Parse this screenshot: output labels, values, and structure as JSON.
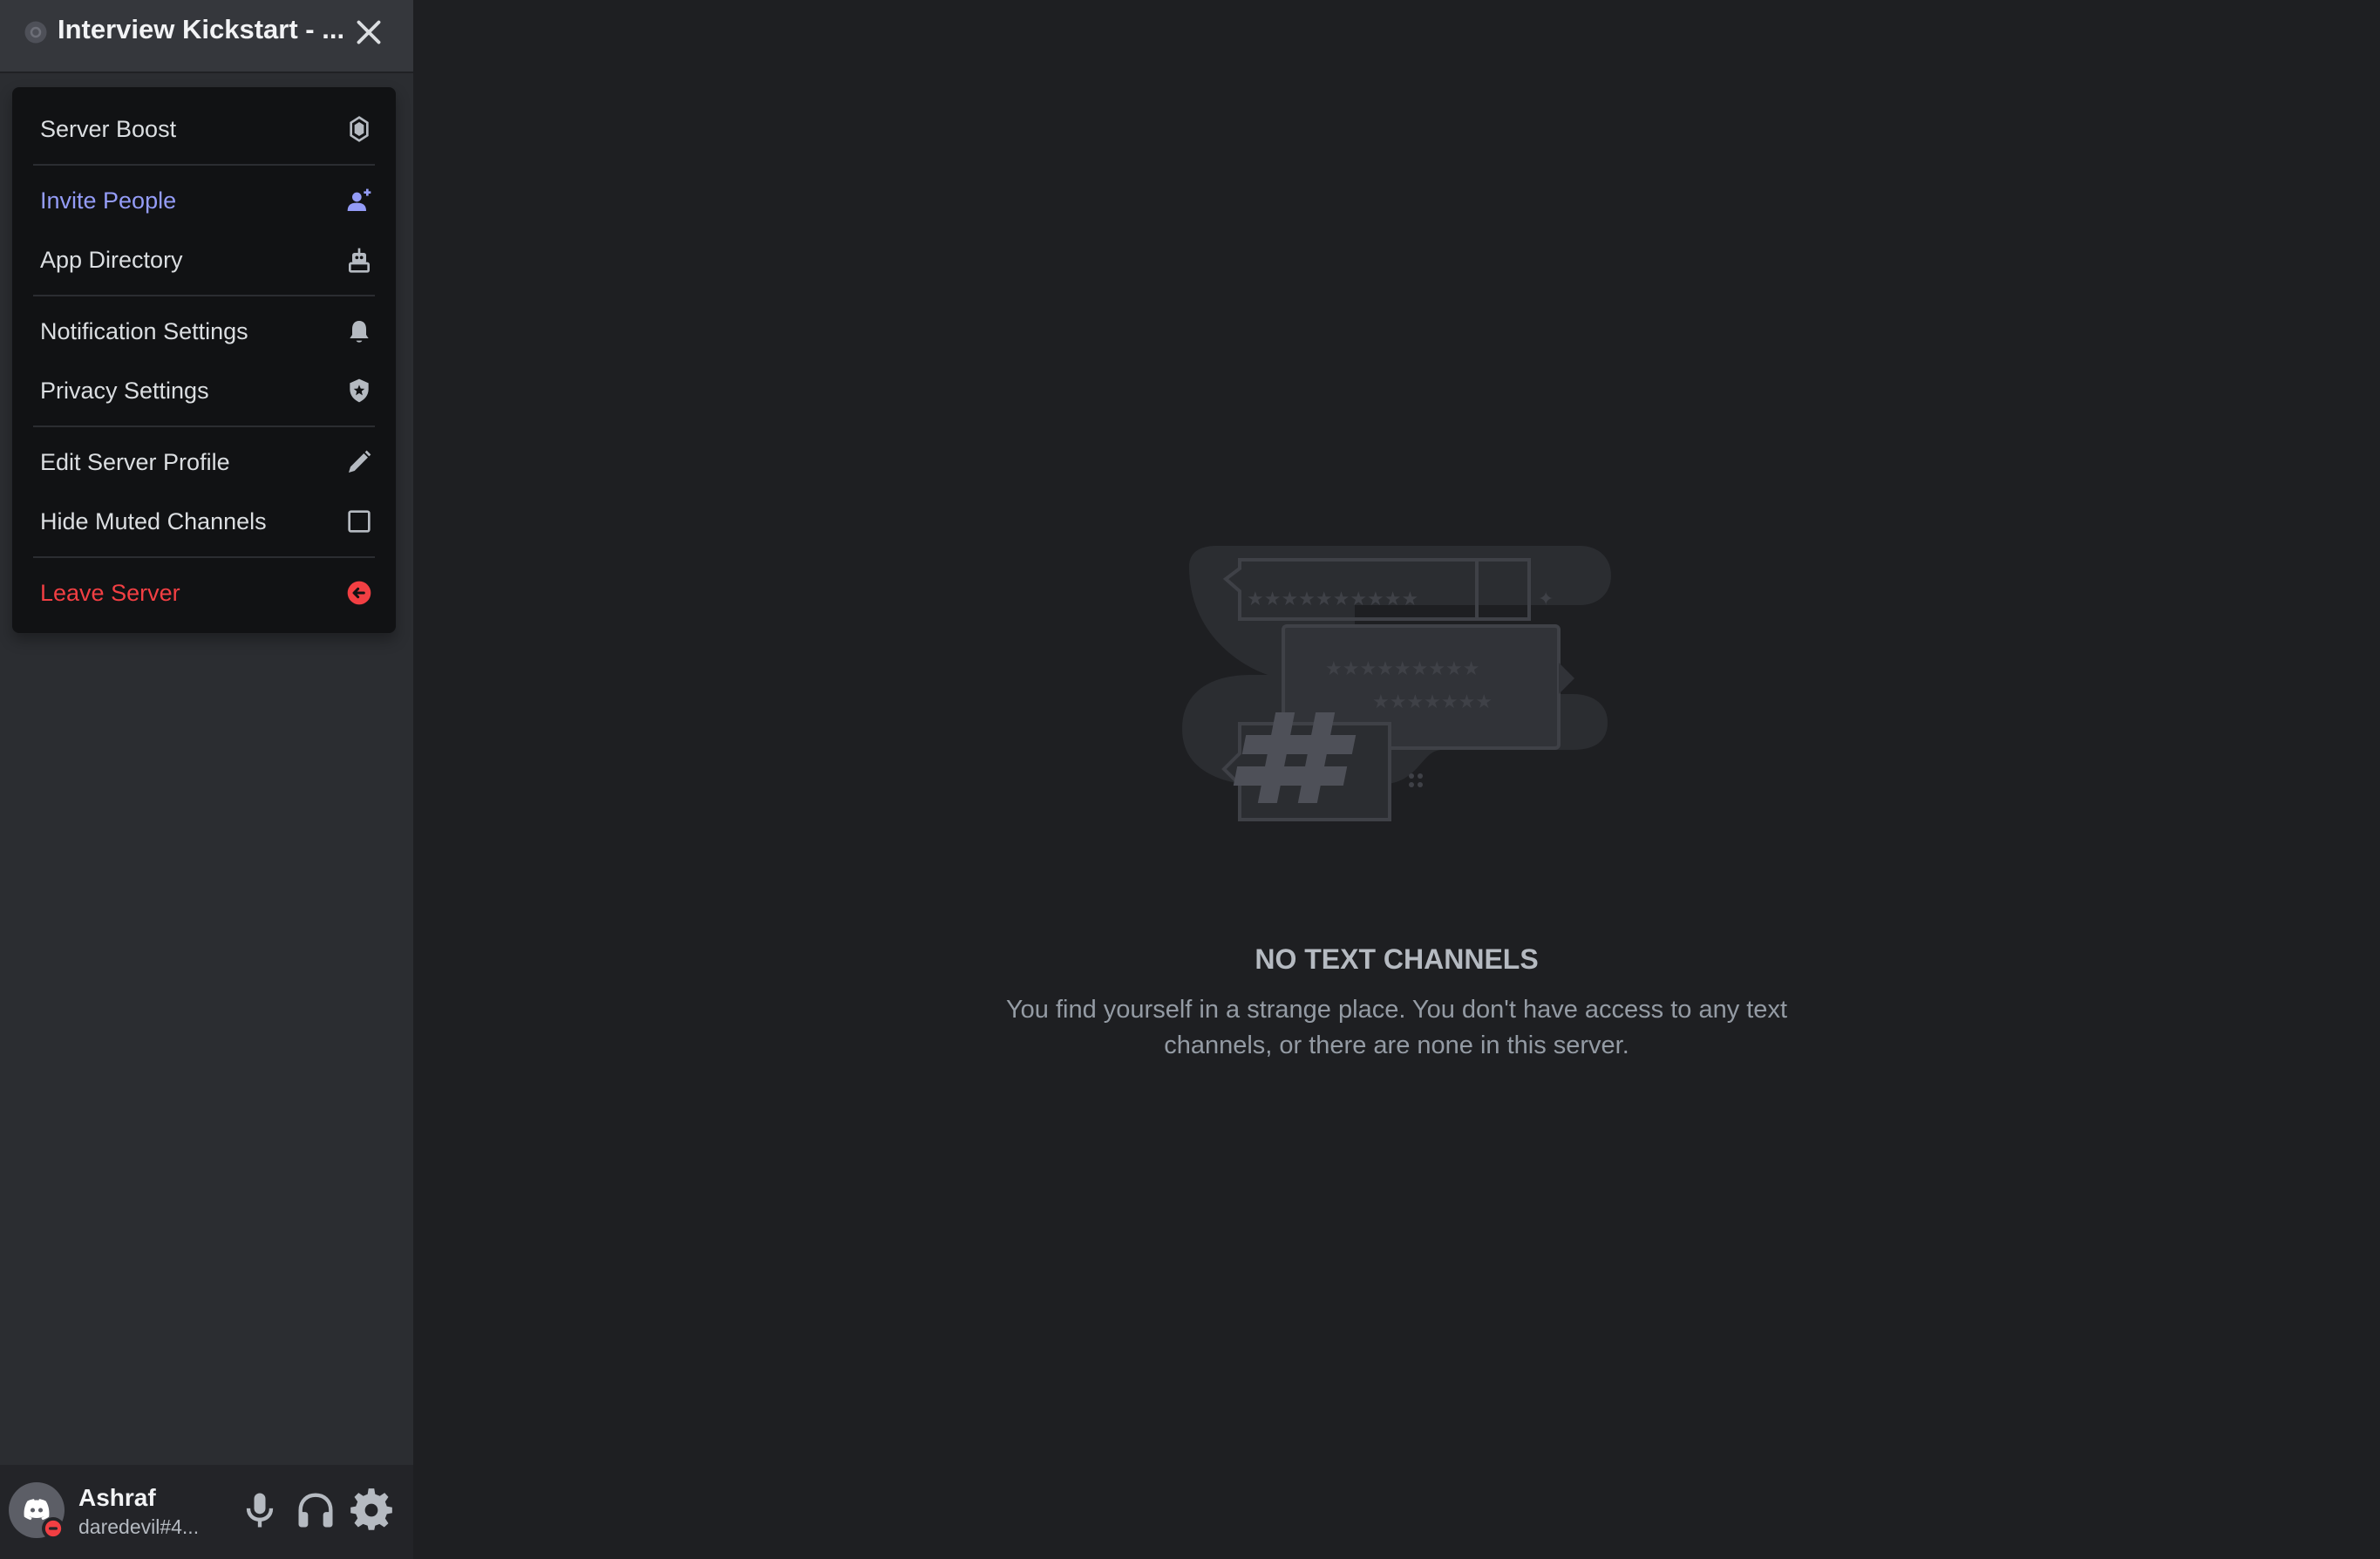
{
  "server": {
    "name": "Interview Kickstart - ...",
    "icon": "server-settings-icon",
    "close_icon": "close-icon"
  },
  "menu": {
    "items": [
      {
        "label": "Server Boost",
        "icon": "boost-gem-icon",
        "color": "#dbdee1"
      },
      {
        "label": "Invite People",
        "icon": "add-user-icon",
        "color": "#949cf7"
      },
      {
        "label": "App Directory",
        "icon": "robot-icon",
        "color": "#dbdee1"
      },
      {
        "label": "Notification Settings",
        "icon": "bell-icon",
        "color": "#dbdee1"
      },
      {
        "label": "Privacy Settings",
        "icon": "shield-star-icon",
        "color": "#dbdee1"
      },
      {
        "label": "Edit Server Profile",
        "icon": "pencil-icon",
        "color": "#dbdee1"
      },
      {
        "label": "Hide Muted Channels",
        "icon": "checkbox-icon",
        "checked": false,
        "color": "#dbdee1"
      },
      {
        "label": "Leave Server",
        "icon": "leave-icon",
        "color": "#f23f43"
      }
    ]
  },
  "user": {
    "name": "Ashraf",
    "tag": "daredevil#4...",
    "status": "do-not-disturb",
    "status_color": "#f23f43",
    "controls": [
      "microphone-icon",
      "headphones-icon",
      "settings-gear-icon"
    ]
  },
  "empty_state": {
    "title": "NO TEXT CHANNELS",
    "description": "You find yourself in a strange place. You don't have access to any text channels, or there are none in this server."
  },
  "colors": {
    "sidebar_bg": "#2b2d31",
    "main_bg": "#1e1f22",
    "menu_bg": "#111214",
    "brand": "#949cf7",
    "danger": "#f23f43"
  }
}
